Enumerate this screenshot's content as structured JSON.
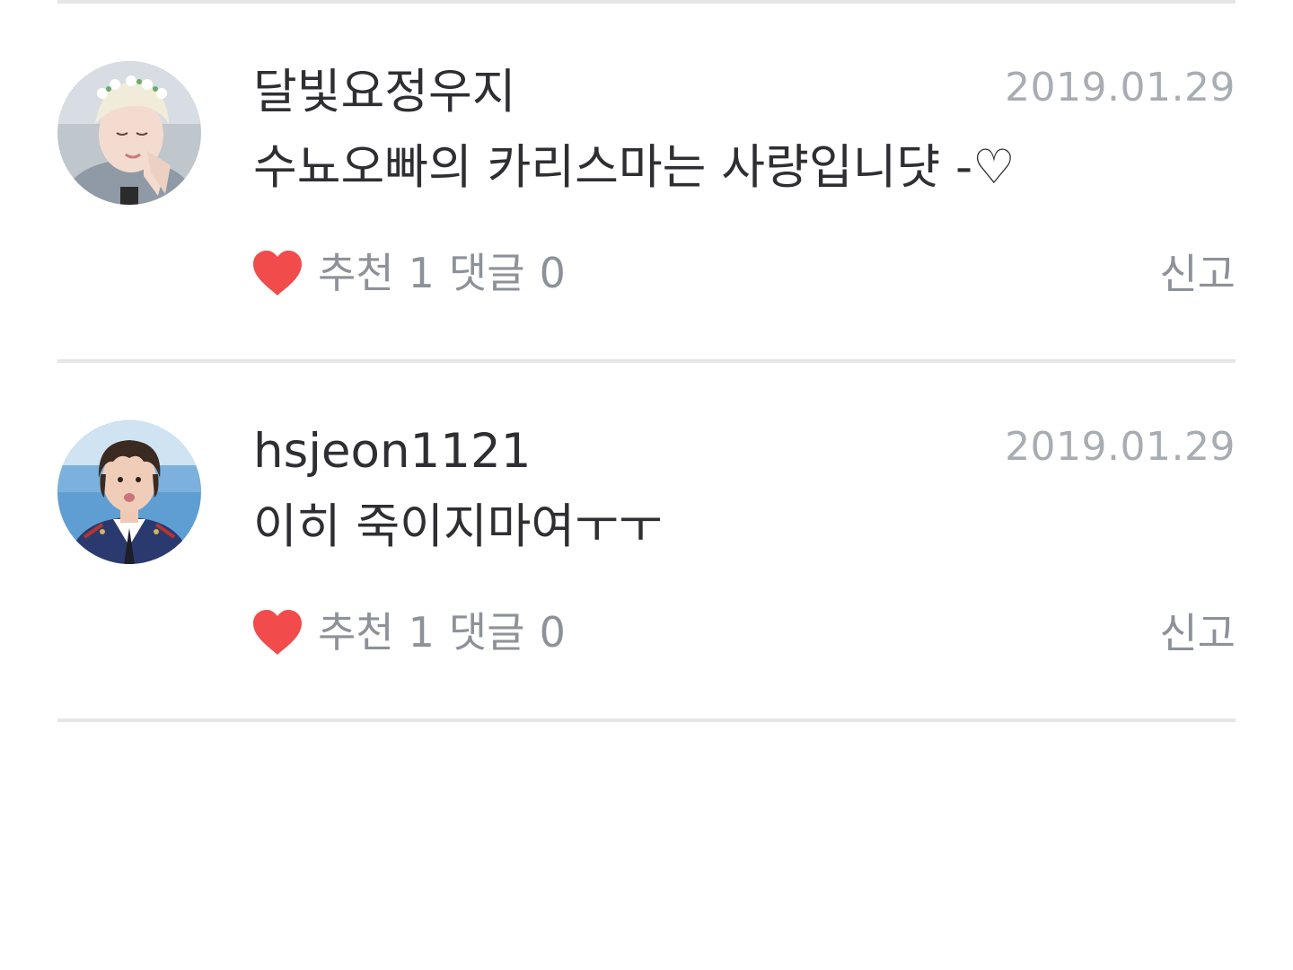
{
  "colors": {
    "divider": "#e6e6e9",
    "text_primary": "#2f2f33",
    "text_muted": "#8d9199",
    "date": "#a8acb3",
    "heart": "#f24b4b"
  },
  "comments": [
    {
      "author": "달빛요정우지",
      "date": "2019.01.29",
      "text": "수뇨오빠의 카리스마는 사량입니댯 -♡",
      "like_icon": "heart-icon",
      "recommend_label": "추천",
      "recommend_count": "1",
      "reply_label": "댓글",
      "reply_count": "0",
      "report_label": "신고"
    },
    {
      "author": "hsjeon1121",
      "date": "2019.01.29",
      "text": "이히 죽이지마여ㅜㅜ",
      "like_icon": "heart-icon",
      "recommend_label": "추천",
      "recommend_count": "1",
      "reply_label": "댓글",
      "reply_count": "0",
      "report_label": "신고"
    }
  ]
}
